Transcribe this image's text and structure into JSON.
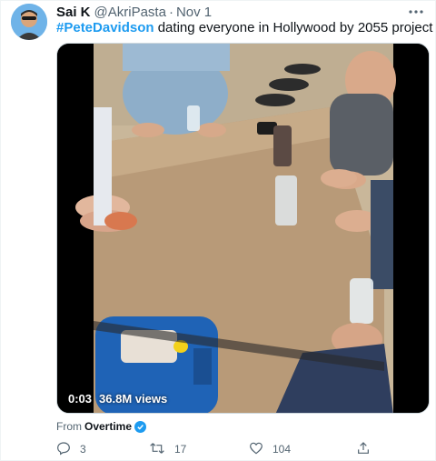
{
  "tweet": {
    "display_name": "Sai K",
    "handle": "@AkriPasta",
    "separator": "·",
    "date": "Nov 1",
    "hashtag": "#PeteDavidson",
    "text": " dating everyone in Hollywood by 2055 project"
  },
  "media": {
    "duration": "0:03",
    "views": "36.8M views"
  },
  "source": {
    "prefix": "From",
    "account": "Overtime"
  },
  "actions": {
    "replies": "3",
    "retweets": "17",
    "likes": "104"
  },
  "colors": {
    "accent": "#1d9bf0",
    "secondary_text": "#536471",
    "primary_text": "#0f1419"
  },
  "icons": [
    "more-icon",
    "verified-icon",
    "reply-icon",
    "retweet-icon",
    "like-icon",
    "share-icon"
  ]
}
